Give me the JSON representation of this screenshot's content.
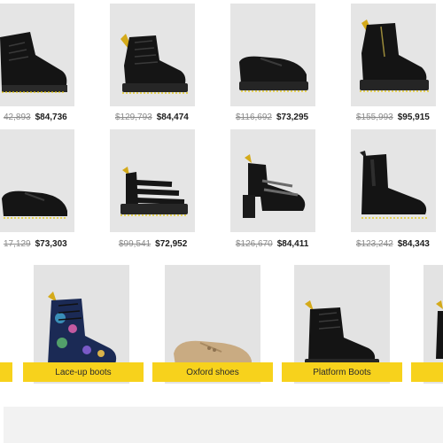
{
  "products": {
    "row1": [
      {
        "old_price": "42,893",
        "new_price": "$84,736",
        "icon": "chelsea-lace-boot-image"
      },
      {
        "old_price": "$129,793",
        "new_price": "$84,474",
        "icon": "lace-up-boot-image"
      },
      {
        "old_price": "$116,692",
        "new_price": "$73,295",
        "icon": "platform-derby-shoe-image"
      },
      {
        "old_price": "$155,993",
        "new_price": "$95,915",
        "icon": "zip-platform-boot-image"
      }
    ],
    "row2": [
      {
        "old_price": "17,129",
        "new_price": "$73,303",
        "icon": "derby-shoe-image"
      },
      {
        "old_price": "$99,541",
        "new_price": "$72,952",
        "icon": "strap-sandal-image"
      },
      {
        "old_price": "$126,670",
        "new_price": "$84,411",
        "icon": "heeled-mary-jane-image"
      },
      {
        "old_price": "$123,242",
        "new_price": "$84,343",
        "icon": "chelsea-boot-image"
      }
    ]
  },
  "categories": [
    {
      "label": "Lace-up boots",
      "icon": "floral-boot-image"
    },
    {
      "label": "Oxford shoes",
      "icon": "suede-oxford-image"
    },
    {
      "label": "Platform Boots",
      "icon": "platform-boot-image"
    }
  ],
  "colors": {
    "card_bg": "#e5e5e5",
    "label_yellow": "#f7d21c",
    "old_price": "#8c8c8c",
    "new_price": "#1c1c1c",
    "footer_band": "#f2f2f2"
  }
}
